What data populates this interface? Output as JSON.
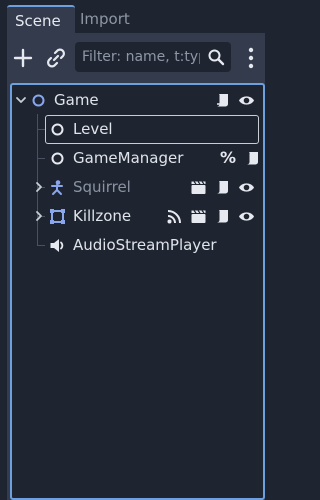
{
  "tabs": [
    {
      "label": "Scene",
      "active": true
    },
    {
      "label": "Import",
      "active": false
    }
  ],
  "toolbar": {
    "add_icon": "plus-icon",
    "link_icon": "link-icon",
    "filter_placeholder": "Filter: name, t:typ",
    "search_icon": "search-icon",
    "menu_icon": "kebab-menu-icon"
  },
  "tree": {
    "nodes": [
      {
        "name": "Game",
        "icon": "node-circle-icon",
        "expanded": true,
        "right_icons": [
          "script-icon",
          "visibility-eye-icon"
        ]
      },
      {
        "name": "Level",
        "icon": "node-circle-icon",
        "selected": true,
        "right_icons": []
      },
      {
        "name": "GameManager",
        "icon": "node-circle-icon",
        "right_icons": [
          "unique-name-percent",
          "script-icon"
        ],
        "percent": "%"
      },
      {
        "name": "Squirrel",
        "icon": "character-body-icon",
        "collapsed": true,
        "dimmed": true,
        "right_icons": [
          "instanced-scene-icon",
          "script-icon",
          "visibility-eye-icon"
        ]
      },
      {
        "name": "Killzone",
        "icon": "area2d-icon",
        "collapsed": true,
        "right_icons": [
          "signal-icon",
          "instanced-scene-icon",
          "script-icon",
          "visibility-eye-icon"
        ]
      },
      {
        "name": "AudioStreamPlayer",
        "icon": "speaker-icon",
        "right_icons": []
      }
    ]
  },
  "colors": {
    "accent": "#6ea0e0",
    "panel": "#333b4d",
    "background": "#1f2530",
    "node_white": "#e6e9ef",
    "node_blue": "#8aa7ee"
  }
}
